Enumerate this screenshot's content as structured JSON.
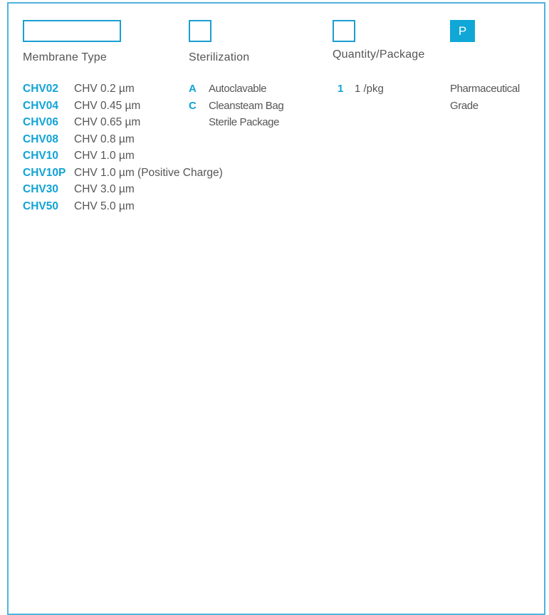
{
  "grade_box": {
    "code": "P"
  },
  "headings": {
    "membrane": "Membrane Type",
    "sterilization": "Sterilization",
    "quantity": "Quantity/Package"
  },
  "membranes": [
    {
      "code": "CHV02",
      "desc": "CHV 0.2 µm"
    },
    {
      "code": "CHV04",
      "desc": "CHV 0.45 µm"
    },
    {
      "code": "CHV06",
      "desc": "CHV 0.65 µm"
    },
    {
      "code": "CHV08",
      "desc": "CHV 0.8 µm"
    },
    {
      "code": "CHV10",
      "desc": "CHV 1.0 µm"
    },
    {
      "code": "CHV10P",
      "desc": "CHV 1.0 µm (Positive Charge)"
    },
    {
      "code": "CHV30",
      "desc": "CHV 3.0 µm"
    },
    {
      "code": "CHV50",
      "desc": "CHV 5.0 µm"
    }
  ],
  "sterilization": [
    {
      "code": "A",
      "desc": "Autoclavable"
    },
    {
      "code": "C",
      "desc": "Cleansteam Bag",
      "desc2": "Sterile Package"
    }
  ],
  "quantity": [
    {
      "code": "1",
      "desc": "1 /pkg"
    }
  ],
  "grade": {
    "line1": "Pharmaceutical",
    "line2": "Grade"
  },
  "colors": {
    "accent": "#10a3d6",
    "frame": "#4fb3dc",
    "text": "#555555"
  }
}
